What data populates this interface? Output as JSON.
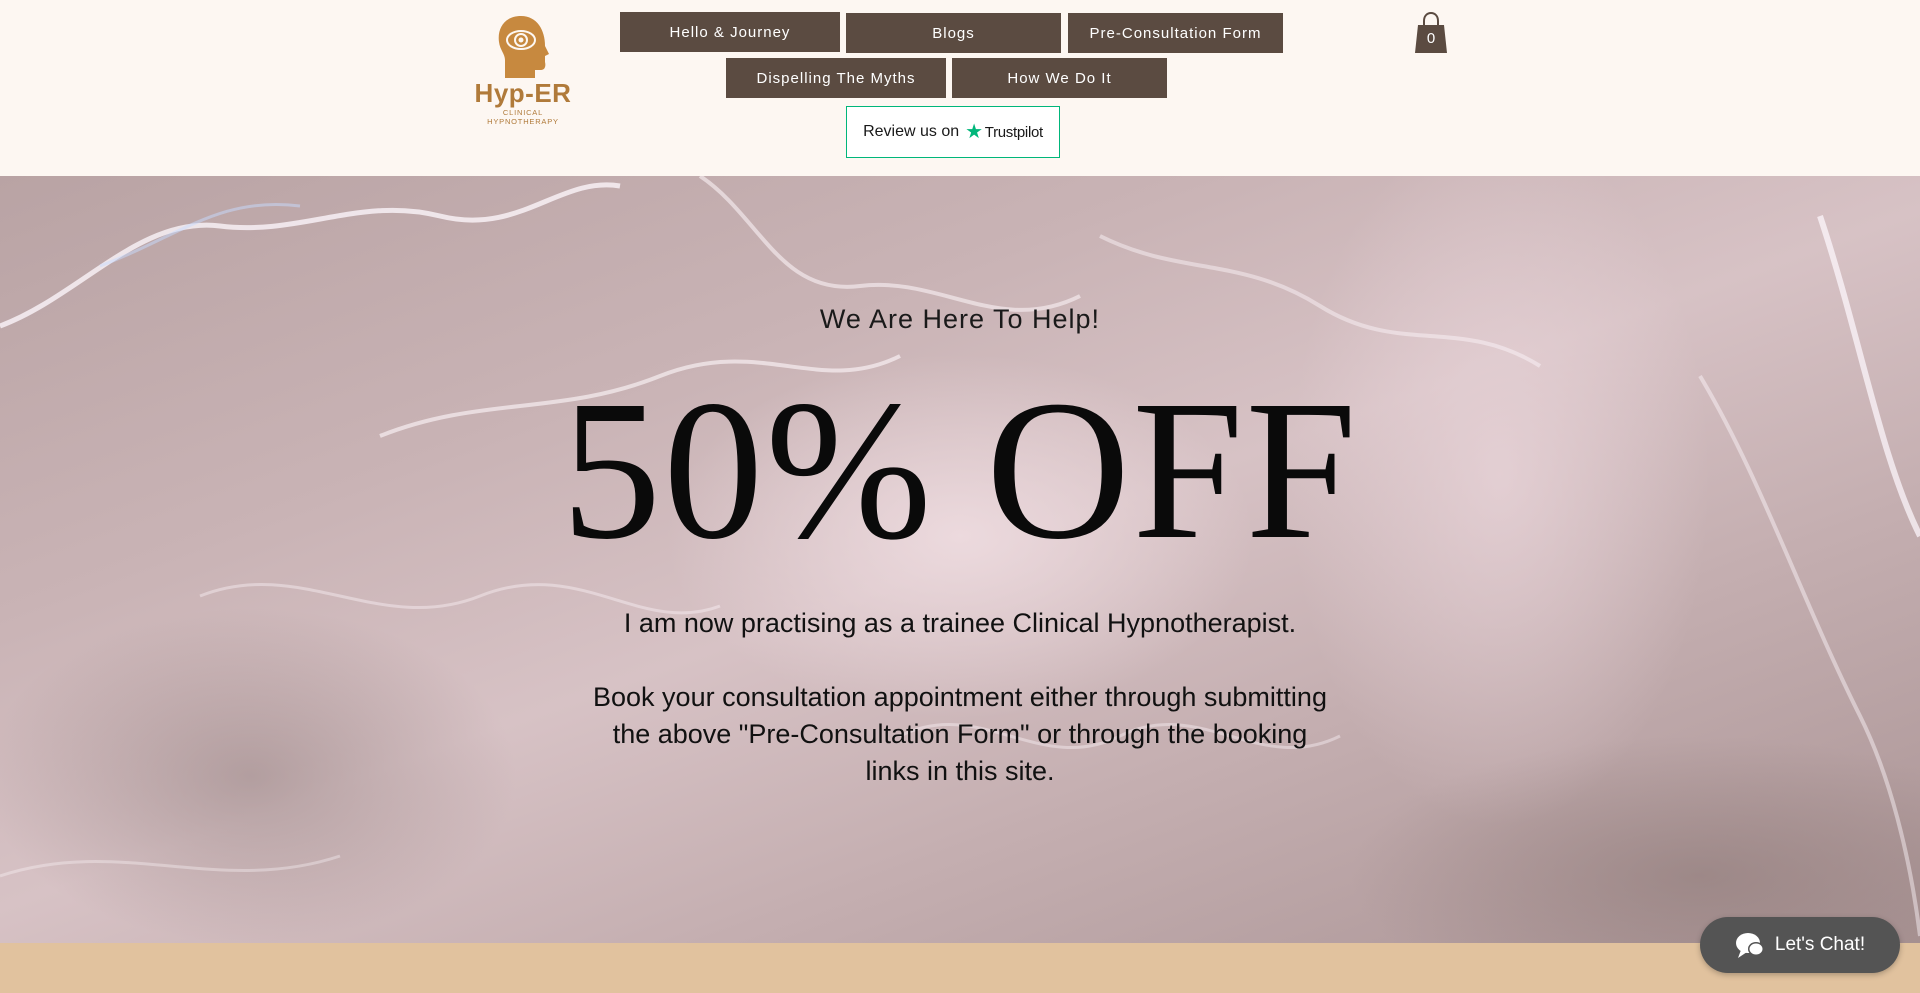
{
  "header": {
    "logo": {
      "brand": "Hyp-ER",
      "tagline": "CLINICAL HYPNOTHERAPY",
      "icon": "head-eye-logo-icon"
    },
    "nav": [
      {
        "label": "Hello & Journey"
      },
      {
        "label": "Blogs"
      },
      {
        "label": "Pre-Consultation Form"
      },
      {
        "label": "Dispelling The Myths"
      },
      {
        "label": "How We Do It"
      }
    ],
    "trustpilot": {
      "text": "Review us on",
      "brand": "Trustpilot",
      "icon": "trustpilot-star-icon"
    },
    "cart": {
      "count": "0",
      "icon": "shopping-bag-icon"
    }
  },
  "hero": {
    "subtitle": "We Are Here To Help!",
    "title": "50% OFF",
    "line1": "I am now practising as a trainee Clinical Hypnotherapist.",
    "line2": "Book your consultation appointment either through submitting the above \"Pre-Consultation Form\" or through the booking links in this site."
  },
  "chat": {
    "label": "Let's Chat!",
    "icon": "chat-bubble-icon"
  },
  "colors": {
    "nav_bg": "#5b4b41",
    "header_bg": "#fdf7f2",
    "brand_gold": "#b07a3a",
    "trustpilot_green": "#00b67a",
    "bottom_strip": "#e1c29e",
    "chat_bg": "#545454"
  }
}
